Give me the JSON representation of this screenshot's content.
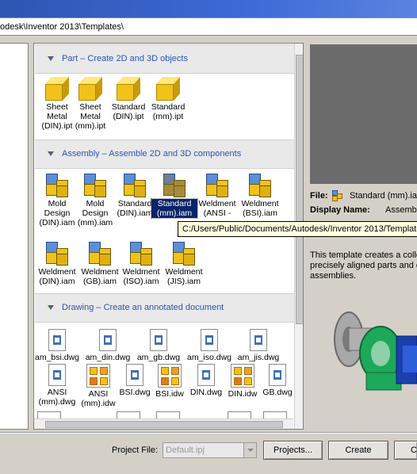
{
  "path_bar": {
    "text": "odesk\\Inventor 2013\\Templates\\"
  },
  "groups": [
    {
      "label": "Part – Create 2D and 3D objects"
    },
    {
      "label": "Assembly – Assemble 2D and 3D components"
    },
    {
      "label": "Drawing – Create an annotated document"
    }
  ],
  "part_items": [
    {
      "label": "Sheet\nMetal\n(DIN).ipt"
    },
    {
      "label": "Sheet\nMetal\n(mm).ipt"
    },
    {
      "label": "Standard\n(DIN).ipt"
    },
    {
      "label": "Standard\n(mm).ipt"
    }
  ],
  "assembly_items": [
    {
      "label": "Mold\nDesign\n(DIN).iam"
    },
    {
      "label": "Mold\nDesign\n(mm).iam"
    },
    {
      "label": "Standard\n(DIN).iam"
    },
    {
      "label": "Standard\n(mm).iam",
      "selected": true
    },
    {
      "label": "Weldment\n(ANSI -"
    },
    {
      "label": "Weldment\n(BSI).iam"
    },
    {
      "label": "Weldment\n(DIN).iam"
    },
    {
      "label": "Weldment\n(GB).iam"
    },
    {
      "label": "Weldment\n(ISO).iam"
    },
    {
      "label": "Weldment\n(JIS).iam"
    }
  ],
  "drawing_items_row1": [
    {
      "label": "am_bsi.dwg"
    },
    {
      "label": "am_din.dwg"
    },
    {
      "label": "am_gb.dwg"
    },
    {
      "label": "am_iso.dwg"
    },
    {
      "label": "am_jis.dwg"
    }
  ],
  "drawing_items_row2": [
    {
      "label": "ANSI\n(mm).dwg"
    },
    {
      "label": "ANSI\n(mm).idw"
    },
    {
      "label": "BSI.dwg"
    },
    {
      "label": "BSI.idw"
    },
    {
      "label": "DIN.dwg"
    },
    {
      "label": "DIN.idw"
    },
    {
      "label": "GB.dwg"
    }
  ],
  "tooltip": {
    "text": "C:/Users/Public/Documents/Autodesk/Inventor 2013/Template"
  },
  "info": {
    "file_label": "File:",
    "file_value": "Standard (mm).ia",
    "display_name_label": "Display Name:",
    "display_name_value": "Assemb",
    "description_lines": [
      "This template creates a colle",
      "precisely aligned parts and c",
      "assemblies."
    ]
  },
  "footer": {
    "project_file_label": "Project File:",
    "project_file_value": "Default.ipj",
    "projects_button": "Projects...",
    "create_button": "Create",
    "cancel_button": "C"
  },
  "colors": {
    "group_header_text": "#2a55b8",
    "selection": "#0a246a",
    "titlebar": "#2e56b2"
  }
}
